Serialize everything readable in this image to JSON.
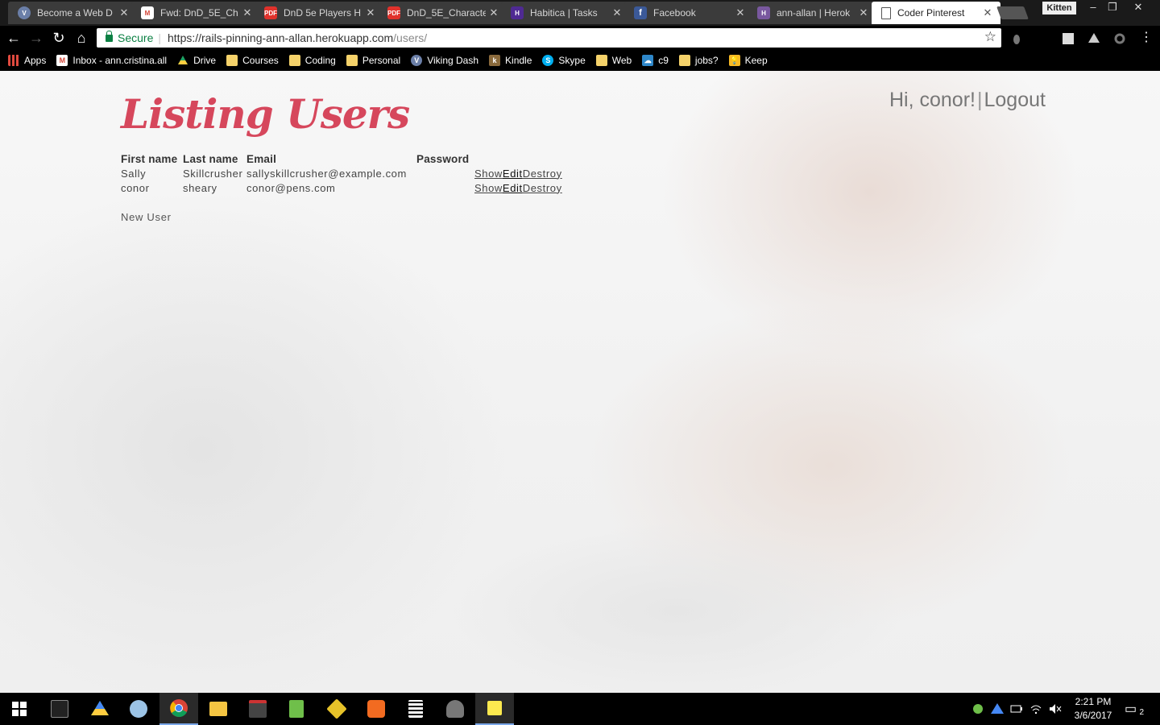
{
  "tabs": [
    {
      "title": "Become a Web D",
      "icon": "vikings-icon",
      "color": "#6b7fa8"
    },
    {
      "title": "Fwd: DnD_5E_Ch",
      "icon": "gmail-icon",
      "color": "#d44638"
    },
    {
      "title": "DnD 5e Players H",
      "icon": "pdf-icon",
      "color": "#e0322c"
    },
    {
      "title": "DnD_5E_Characte",
      "icon": "pdf-icon",
      "color": "#e0322c"
    },
    {
      "title": "Habitica | Tasks",
      "icon": "habitica-icon",
      "color": "#4f2a93"
    },
    {
      "title": "Facebook",
      "icon": "facebook-icon",
      "color": "#3b5998"
    },
    {
      "title": "ann-allan | Herok",
      "icon": "heroku-icon",
      "color": "#79589f"
    },
    {
      "title": "Coder Pinterest",
      "icon": "page-icon",
      "color": "#ffffff"
    }
  ],
  "profile_name": "Kitten",
  "toolbar": {
    "secure_label": "Secure",
    "url_host": "https://rails-pinning-ann-allan.herokuapp.com",
    "url_path": "/users/"
  },
  "bookmarks": [
    {
      "label": "Apps",
      "icon": "apps-grid-icon",
      "color": "#e04a3f"
    },
    {
      "label": "Inbox - ann.cristina.all",
      "icon": "gmail-icon",
      "color": "#d44638"
    },
    {
      "label": "Drive",
      "icon": "drive-icon",
      "color": "#1fa463"
    },
    {
      "label": "Courses",
      "icon": "folder-icon",
      "color": "#f5d26a"
    },
    {
      "label": "Coding",
      "icon": "folder-icon",
      "color": "#f5d26a"
    },
    {
      "label": "Personal",
      "icon": "folder-icon",
      "color": "#f5d26a"
    },
    {
      "label": "Viking Dash",
      "icon": "vikings-icon",
      "color": "#6b7fa8"
    },
    {
      "label": "Kindle",
      "icon": "kindle-icon",
      "color": "#8a6a3c"
    },
    {
      "label": "Skype",
      "icon": "skype-icon",
      "color": "#00aff0"
    },
    {
      "label": "Web",
      "icon": "folder-icon",
      "color": "#f5d26a"
    },
    {
      "label": "c9",
      "icon": "cloud9-icon",
      "color": "#2e87c9"
    },
    {
      "label": "jobs?",
      "icon": "folder-icon",
      "color": "#f5d26a"
    },
    {
      "label": "Keep",
      "icon": "keep-icon",
      "color": "#f7b924"
    }
  ],
  "page": {
    "title": "Listing Users",
    "greeting": "Hi, conor!",
    "divider": "|",
    "logout": "Logout",
    "columns": [
      "First name",
      "Last name",
      "Email",
      "Password"
    ],
    "rows": [
      {
        "first": "Sally",
        "last": "Skillcrusher",
        "email": "sallyskillcrusher@example.com",
        "password": ""
      },
      {
        "first": "conor",
        "last": "sheary",
        "email": "conor@pens.com",
        "password": ""
      }
    ],
    "actions": {
      "show": "Show",
      "edit": "Edit",
      "destroy": "Destroy"
    },
    "new_user": "New User",
    "accent_color": "#d6475c"
  },
  "taskbar": {
    "apps": [
      "windows-start-icon",
      "terminal-icon",
      "drive-icon",
      "paint-icon",
      "chrome-icon",
      "file-explorer-icon",
      "media-icon",
      "notepad-icon",
      "git-kraken-icon",
      "sublime-icon",
      "calculator-icon",
      "snipping-icon",
      "sticky-notes-icon"
    ],
    "time": "2:21 PM",
    "date": "3/6/2017",
    "notification_count": "2"
  }
}
